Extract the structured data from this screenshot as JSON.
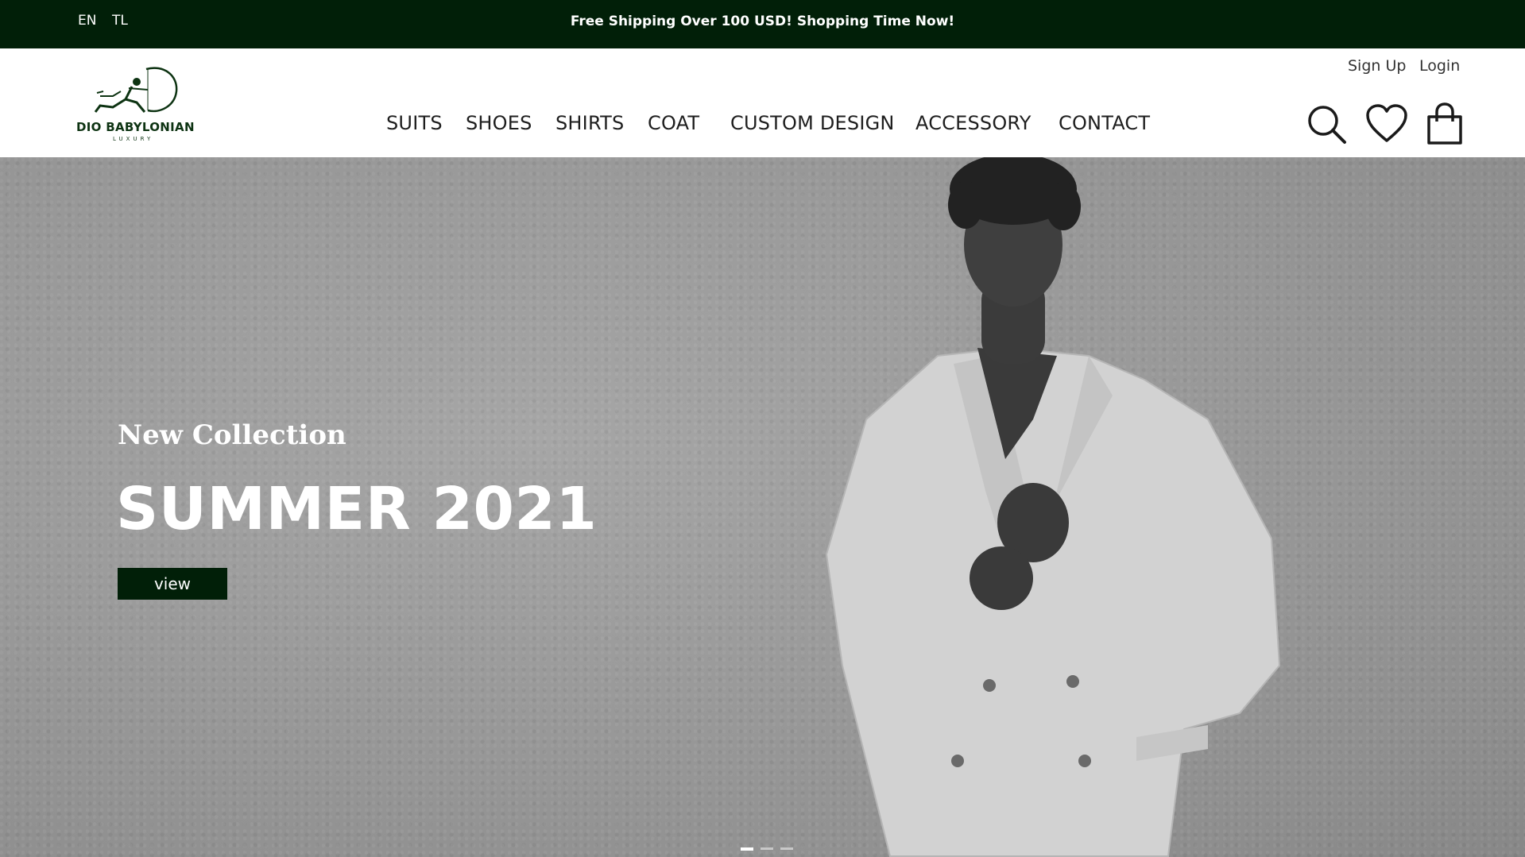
{
  "topbar": {
    "languages": [
      "EN",
      "TL"
    ],
    "promo": "Free Shipping Over 100 USD! Shopping Time Now!"
  },
  "header": {
    "logo_text": "DIO BABYLONIAN",
    "logo_sub": "LUXURY",
    "auth": {
      "signup": "Sign Up",
      "login": "Login"
    },
    "nav": [
      "SUITS",
      "SHOES",
      "SHIRTS",
      "COAT",
      "CUSTOM DESIGN",
      "ACCESSORY",
      "CONTACT"
    ],
    "icons": [
      "search-icon",
      "heart-icon",
      "shopping-bag-icon"
    ]
  },
  "hero": {
    "eyebrow": "New Collection",
    "title": "SUMMER 2021",
    "cta": "view",
    "slides": 3,
    "active_slide": 1
  },
  "colors": {
    "brand": "#011f08",
    "nav_text": "#1e1e1e",
    "hero_bg": "#9b9b9b"
  }
}
